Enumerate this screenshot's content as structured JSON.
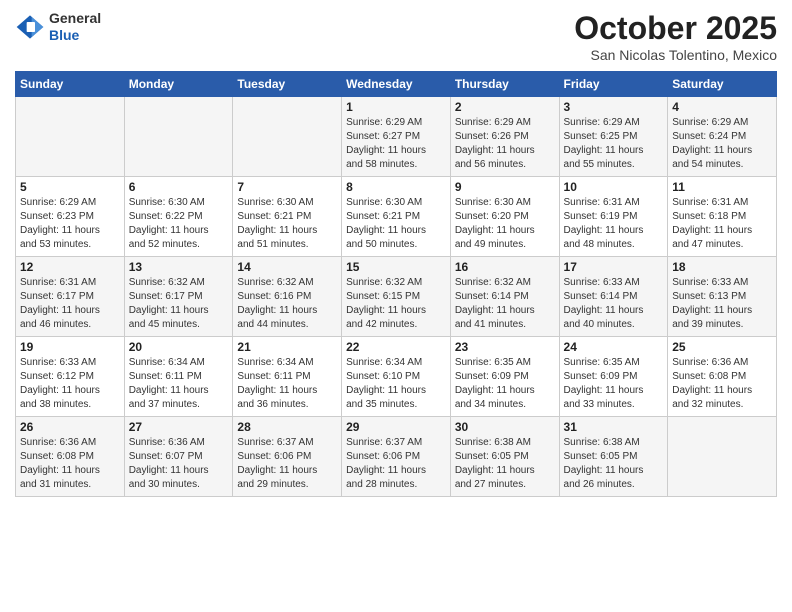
{
  "header": {
    "logo_line1": "General",
    "logo_line2": "Blue",
    "month": "October 2025",
    "location": "San Nicolas Tolentino, Mexico"
  },
  "weekdays": [
    "Sunday",
    "Monday",
    "Tuesday",
    "Wednesday",
    "Thursday",
    "Friday",
    "Saturday"
  ],
  "weeks": [
    [
      {
        "day": "",
        "info": ""
      },
      {
        "day": "",
        "info": ""
      },
      {
        "day": "",
        "info": ""
      },
      {
        "day": "1",
        "info": "Sunrise: 6:29 AM\nSunset: 6:27 PM\nDaylight: 11 hours\nand 58 minutes."
      },
      {
        "day": "2",
        "info": "Sunrise: 6:29 AM\nSunset: 6:26 PM\nDaylight: 11 hours\nand 56 minutes."
      },
      {
        "day": "3",
        "info": "Sunrise: 6:29 AM\nSunset: 6:25 PM\nDaylight: 11 hours\nand 55 minutes."
      },
      {
        "day": "4",
        "info": "Sunrise: 6:29 AM\nSunset: 6:24 PM\nDaylight: 11 hours\nand 54 minutes."
      }
    ],
    [
      {
        "day": "5",
        "info": "Sunrise: 6:29 AM\nSunset: 6:23 PM\nDaylight: 11 hours\nand 53 minutes."
      },
      {
        "day": "6",
        "info": "Sunrise: 6:30 AM\nSunset: 6:22 PM\nDaylight: 11 hours\nand 52 minutes."
      },
      {
        "day": "7",
        "info": "Sunrise: 6:30 AM\nSunset: 6:21 PM\nDaylight: 11 hours\nand 51 minutes."
      },
      {
        "day": "8",
        "info": "Sunrise: 6:30 AM\nSunset: 6:21 PM\nDaylight: 11 hours\nand 50 minutes."
      },
      {
        "day": "9",
        "info": "Sunrise: 6:30 AM\nSunset: 6:20 PM\nDaylight: 11 hours\nand 49 minutes."
      },
      {
        "day": "10",
        "info": "Sunrise: 6:31 AM\nSunset: 6:19 PM\nDaylight: 11 hours\nand 48 minutes."
      },
      {
        "day": "11",
        "info": "Sunrise: 6:31 AM\nSunset: 6:18 PM\nDaylight: 11 hours\nand 47 minutes."
      }
    ],
    [
      {
        "day": "12",
        "info": "Sunrise: 6:31 AM\nSunset: 6:17 PM\nDaylight: 11 hours\nand 46 minutes."
      },
      {
        "day": "13",
        "info": "Sunrise: 6:32 AM\nSunset: 6:17 PM\nDaylight: 11 hours\nand 45 minutes."
      },
      {
        "day": "14",
        "info": "Sunrise: 6:32 AM\nSunset: 6:16 PM\nDaylight: 11 hours\nand 44 minutes."
      },
      {
        "day": "15",
        "info": "Sunrise: 6:32 AM\nSunset: 6:15 PM\nDaylight: 11 hours\nand 42 minutes."
      },
      {
        "day": "16",
        "info": "Sunrise: 6:32 AM\nSunset: 6:14 PM\nDaylight: 11 hours\nand 41 minutes."
      },
      {
        "day": "17",
        "info": "Sunrise: 6:33 AM\nSunset: 6:14 PM\nDaylight: 11 hours\nand 40 minutes."
      },
      {
        "day": "18",
        "info": "Sunrise: 6:33 AM\nSunset: 6:13 PM\nDaylight: 11 hours\nand 39 minutes."
      }
    ],
    [
      {
        "day": "19",
        "info": "Sunrise: 6:33 AM\nSunset: 6:12 PM\nDaylight: 11 hours\nand 38 minutes."
      },
      {
        "day": "20",
        "info": "Sunrise: 6:34 AM\nSunset: 6:11 PM\nDaylight: 11 hours\nand 37 minutes."
      },
      {
        "day": "21",
        "info": "Sunrise: 6:34 AM\nSunset: 6:11 PM\nDaylight: 11 hours\nand 36 minutes."
      },
      {
        "day": "22",
        "info": "Sunrise: 6:34 AM\nSunset: 6:10 PM\nDaylight: 11 hours\nand 35 minutes."
      },
      {
        "day": "23",
        "info": "Sunrise: 6:35 AM\nSunset: 6:09 PM\nDaylight: 11 hours\nand 34 minutes."
      },
      {
        "day": "24",
        "info": "Sunrise: 6:35 AM\nSunset: 6:09 PM\nDaylight: 11 hours\nand 33 minutes."
      },
      {
        "day": "25",
        "info": "Sunrise: 6:36 AM\nSunset: 6:08 PM\nDaylight: 11 hours\nand 32 minutes."
      }
    ],
    [
      {
        "day": "26",
        "info": "Sunrise: 6:36 AM\nSunset: 6:08 PM\nDaylight: 11 hours\nand 31 minutes."
      },
      {
        "day": "27",
        "info": "Sunrise: 6:36 AM\nSunset: 6:07 PM\nDaylight: 11 hours\nand 30 minutes."
      },
      {
        "day": "28",
        "info": "Sunrise: 6:37 AM\nSunset: 6:06 PM\nDaylight: 11 hours\nand 29 minutes."
      },
      {
        "day": "29",
        "info": "Sunrise: 6:37 AM\nSunset: 6:06 PM\nDaylight: 11 hours\nand 28 minutes."
      },
      {
        "day": "30",
        "info": "Sunrise: 6:38 AM\nSunset: 6:05 PM\nDaylight: 11 hours\nand 27 minutes."
      },
      {
        "day": "31",
        "info": "Sunrise: 6:38 AM\nSunset: 6:05 PM\nDaylight: 11 hours\nand 26 minutes."
      },
      {
        "day": "",
        "info": ""
      }
    ]
  ]
}
